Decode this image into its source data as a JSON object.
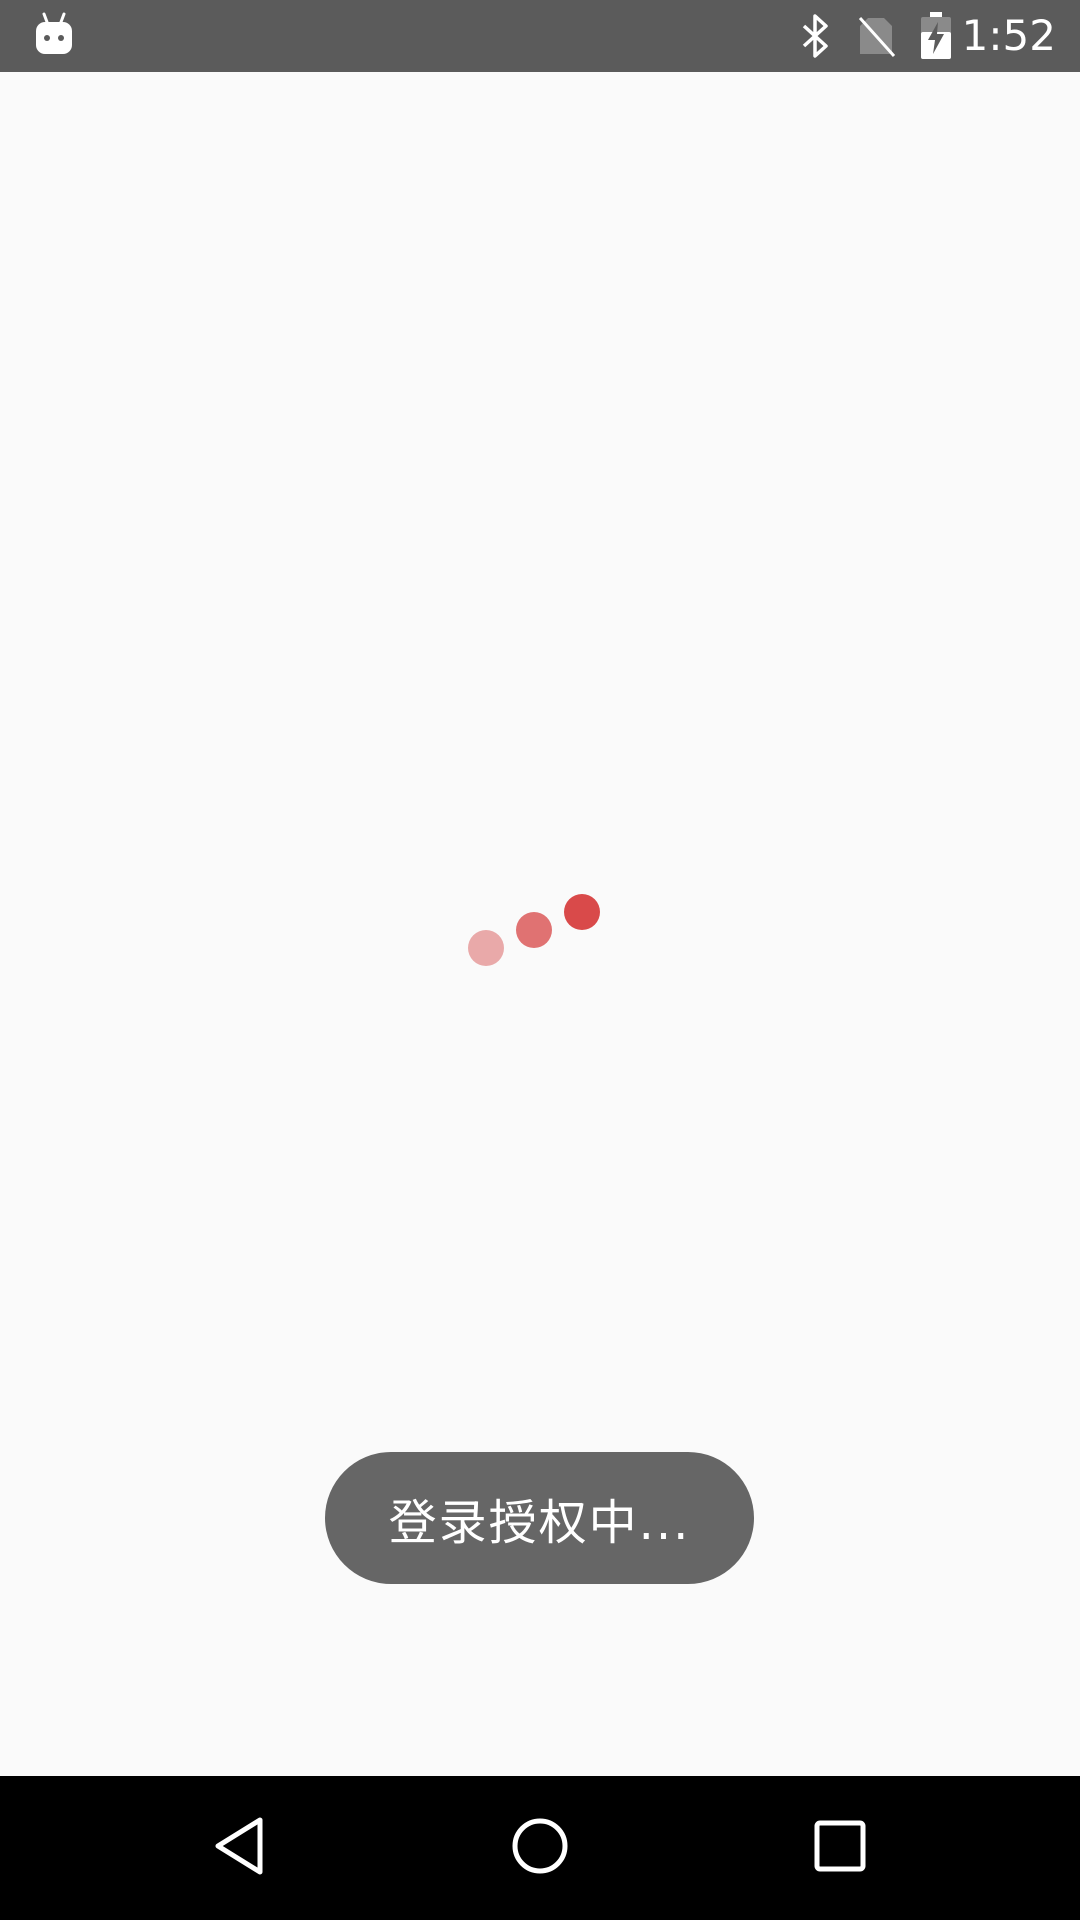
{
  "status_bar": {
    "time": "1:52",
    "icons": [
      "android-app-icon",
      "bluetooth-icon",
      "no-sim-icon",
      "battery-charging-icon"
    ]
  },
  "loading": {
    "dot_colors": [
      "#e9a9a9",
      "#e07272",
      "#d94a4a"
    ]
  },
  "toast": {
    "message": "登录授权中..."
  },
  "nav_bar": {
    "buttons": [
      "back-icon",
      "home-icon",
      "recents-icon"
    ]
  },
  "colors": {
    "status_bar_bg": "#5b5b5b",
    "content_bg": "#fafafa",
    "toast_bg": "#666666",
    "nav_bar_bg": "#000000"
  }
}
